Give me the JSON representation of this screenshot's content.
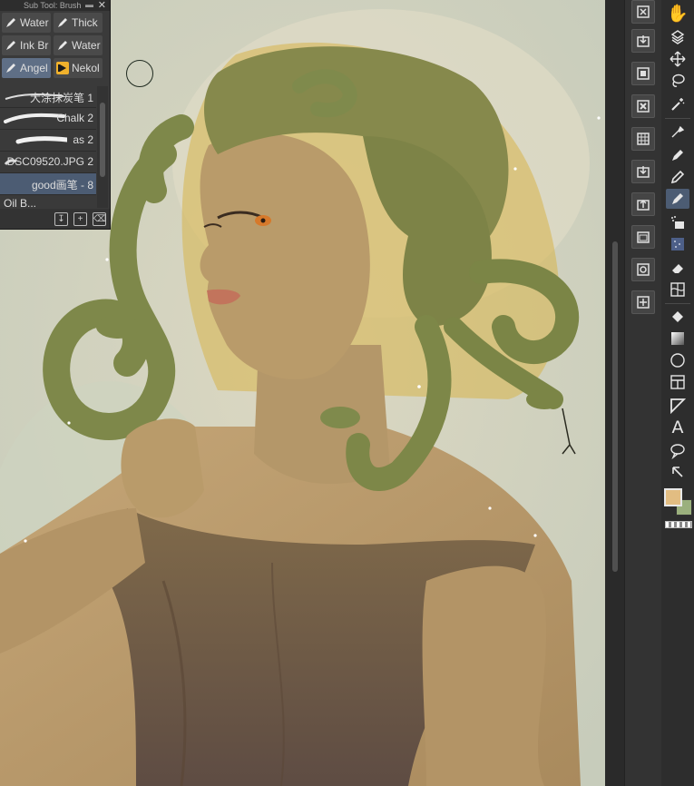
{
  "subtool": {
    "title": "Sub Tool: Brush",
    "tabs": [
      {
        "label": "Water",
        "icon": "brush-pen-icon",
        "active": false
      },
      {
        "label": "Thick",
        "icon": "brush-pen-icon",
        "active": false
      },
      {
        "label": "Ink Br",
        "icon": "brush-pen-icon",
        "active": false
      },
      {
        "label": "Water",
        "icon": "brush-pen-icon",
        "active": false
      },
      {
        "label": "Angel",
        "icon": "brush-pen-icon",
        "active": true
      },
      {
        "label": "Nekol",
        "icon": "nekol-brand-icon",
        "active": false
      }
    ],
    "brushes": [
      {
        "name": "大涂抹炭笔 1",
        "selected": false
      },
      {
        "name": "Chalk 2",
        "selected": false
      },
      {
        "name": "as 2",
        "selected": false
      },
      {
        "name": "DSC09520.JPG 2",
        "selected": false
      },
      {
        "name": "good画笔 - 8",
        "selected": true
      },
      {
        "name": "Oil B...",
        "selected": false
      }
    ]
  },
  "commands": [
    "fit-screen-icon",
    "import-icon",
    "layer-icon",
    "close-doc-icon",
    "grid-icon",
    "import-icon",
    "export-icon",
    "folder-icon",
    "copy-layer-icon",
    "merge-icon"
  ],
  "tools": [
    "hand-icon",
    "rotate-view-icon",
    "move-icon",
    "lasso-icon",
    "magic-wand-icon",
    "eyedropper-icon",
    "pen-icon",
    "pencil-icon",
    "brush-icon",
    "airbrush-icon",
    "decoration-icon",
    "eraser-icon",
    "blend-icon",
    "fill-icon",
    "gradient-icon",
    "figure-icon",
    "frame-icon",
    "ruler-icon",
    "text-icon",
    "balloon-icon",
    "correct-line-icon"
  ],
  "colors": {
    "main": "#e2bd82",
    "sub": "#9bb07d",
    "accent": "#4c5c73"
  }
}
